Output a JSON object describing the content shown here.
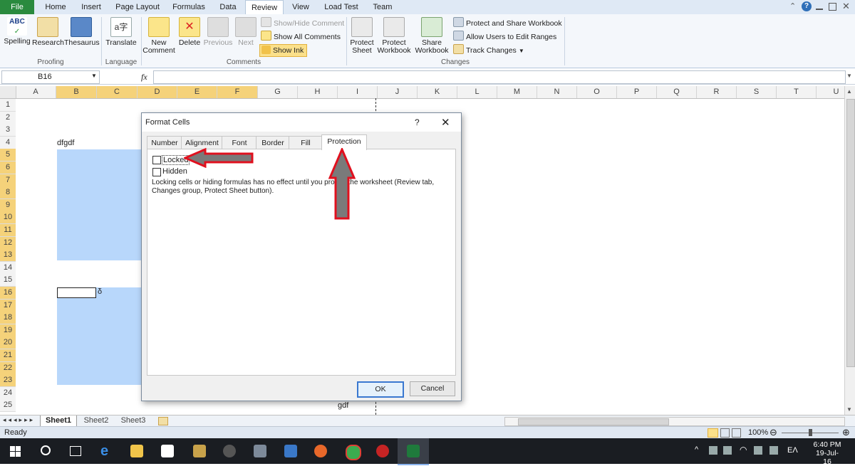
{
  "tabs": [
    "File",
    "Home",
    "Insert",
    "Page Layout",
    "Formulas",
    "Data",
    "Review",
    "View",
    "Load Test",
    "Team"
  ],
  "active_tab": "Review",
  "ribbon": {
    "proofing": {
      "spelling": "Spelling",
      "research": "Research",
      "thesaurus": "Thesaurus",
      "label": "Proofing"
    },
    "language": {
      "translate": "Translate",
      "label": "Language"
    },
    "comments": {
      "new": "New",
      "new2": "Comment",
      "delete": "Delete",
      "previous": "Previous",
      "next": "Next",
      "show_hide": "Show/Hide Comment",
      "show_all": "Show All Comments",
      "show_ink": "Show Ink",
      "label": "Comments"
    },
    "changes": {
      "protect_sheet": "Protect",
      "protect_sheet2": "Sheet",
      "protect_wb": "Protect",
      "protect_wb2": "Workbook",
      "share_wb": "Share",
      "share_wb2": "Workbook",
      "protect_share": "Protect and Share Workbook",
      "allow_edit": "Allow Users to Edit Ranges",
      "track": "Track Changes",
      "label": "Changes"
    },
    "abc": "ABC"
  },
  "namebox": "B16",
  "fx": "fx",
  "columns": [
    "A",
    "B",
    "C",
    "D",
    "E",
    "F",
    "G",
    "H",
    "I",
    "J",
    "K",
    "L",
    "M",
    "N",
    "O",
    "P",
    "Q",
    "R",
    "S",
    "T",
    "U"
  ],
  "rows": [
    "1",
    "2",
    "3",
    "4",
    "5",
    "6",
    "7",
    "8",
    "9",
    "10",
    "11",
    "12",
    "13",
    "14",
    "15",
    "16",
    "17",
    "18",
    "19",
    "20",
    "21",
    "22",
    "23",
    "24",
    "25"
  ],
  "cells": {
    "b4": "dfgdf",
    "c16": "δ",
    "i25": "gdf"
  },
  "sheets": [
    "Sheet1",
    "Sheet2",
    "Sheet3"
  ],
  "status": {
    "ready": "Ready",
    "zoom": "100%"
  },
  "dialog": {
    "title": "Format Cells",
    "help": "?",
    "tabs": [
      "Number",
      "Alignment",
      "Font",
      "Border",
      "Fill",
      "Protection"
    ],
    "locked": "Locked",
    "hidden": "Hidden",
    "note": "Locking cells or hiding formulas has no effect until you protect the worksheet (Review tab, Changes group, Protect Sheet button).",
    "ok": "OK",
    "cancel": "Cancel"
  },
  "taskbar": {
    "lang": "ΕΛ",
    "time": "6:40 PM",
    "date": "19-Jul-16"
  },
  "colors": {
    "file_tab": "#2a8a3e",
    "selection": "#b8d7fb",
    "header_sel": "#f5d27a",
    "arrow": "#e0101e",
    "taskbar": "#1a1d22"
  }
}
